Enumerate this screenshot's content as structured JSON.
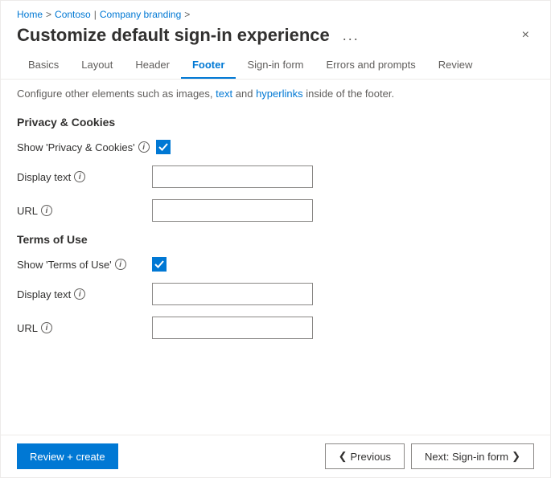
{
  "breadcrumb": {
    "home": "Home",
    "separator1": ">",
    "contoso": "Contoso",
    "separator2": "|",
    "company_branding": "Company branding",
    "separator3": ">"
  },
  "title": "Customize default sign-in experience",
  "ellipsis": "...",
  "close": "×",
  "tabs": [
    {
      "id": "basics",
      "label": "Basics",
      "active": false
    },
    {
      "id": "layout",
      "label": "Layout",
      "active": false
    },
    {
      "id": "header",
      "label": "Header",
      "active": false
    },
    {
      "id": "footer",
      "label": "Footer",
      "active": true
    },
    {
      "id": "signin-form",
      "label": "Sign-in form",
      "active": false
    },
    {
      "id": "errors-prompts",
      "label": "Errors and prompts",
      "active": false
    },
    {
      "id": "review",
      "label": "Review",
      "active": false
    }
  ],
  "info_bar": {
    "prefix": "Configure other elements such as images,",
    "link1": "text",
    "middle": "and",
    "link2": "hyperlinks",
    "suffix": "inside of the footer."
  },
  "privacy_section": {
    "title": "Privacy & Cookies",
    "show_label": "Show 'Privacy & Cookies'",
    "show_checked": true,
    "display_text_label": "Display text",
    "display_text_value": "",
    "display_text_placeholder": "",
    "url_label": "URL",
    "url_value": "",
    "url_placeholder": ""
  },
  "terms_section": {
    "title": "Terms of Use",
    "show_label": "Show 'Terms of Use'",
    "show_checked": true,
    "display_text_label": "Display text",
    "display_text_value": "",
    "display_text_placeholder": "",
    "url_label": "URL",
    "url_value": "",
    "url_placeholder": ""
  },
  "footer": {
    "review_create": "Review + create",
    "previous": "Previous",
    "next": "Next: Sign-in form"
  },
  "icons": {
    "chevron_left": "❮",
    "chevron_right": "❯",
    "info": "i"
  }
}
